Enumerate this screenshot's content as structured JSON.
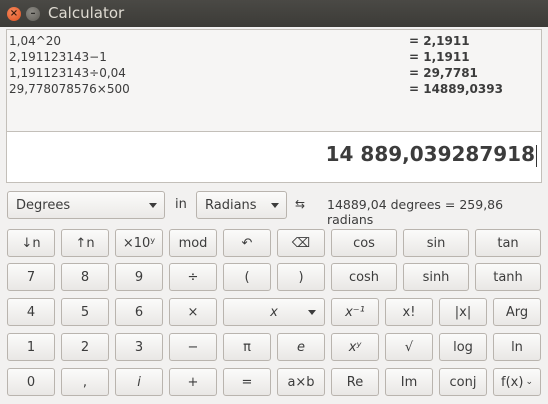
{
  "window": {
    "title": "Calculator"
  },
  "history": [
    {
      "expr": "1,04^20",
      "result": "= 2,1911"
    },
    {
      "expr": "2,191123143−1",
      "result": "= 1,1911"
    },
    {
      "expr": "1,191123143÷0,04",
      "result": "= 29,7781"
    },
    {
      "expr": "29,778078576×500",
      "result": "= 14889,0393"
    }
  ],
  "display": {
    "value": "14 889,039287918"
  },
  "conversion": {
    "from_unit": "Degrees",
    "in_label": "in",
    "to_unit": "Radians",
    "swap_icon": "⇆",
    "result": "14889,04 degrees = 259,86 radians"
  },
  "keys": {
    "row1": [
      "↓n",
      "↑n",
      "×10ʸ",
      "mod",
      "↶",
      "⌫",
      "cos",
      "sin",
      "tan"
    ],
    "row2": [
      "7",
      "8",
      "9",
      "÷",
      "(",
      ")",
      "cosh",
      "sinh",
      "tanh"
    ],
    "row3": [
      "4",
      "5",
      "6",
      "×",
      "x",
      "x⁻¹",
      "x!",
      "|x|",
      "Arg"
    ],
    "row4": [
      "1",
      "2",
      "3",
      "−",
      "π",
      "e",
      "xʸ",
      "√",
      "log",
      "ln"
    ],
    "row5": [
      "0",
      ",",
      "i",
      "+",
      "=",
      "a×b",
      "Re",
      "Im",
      "conj",
      "f(x)"
    ]
  }
}
